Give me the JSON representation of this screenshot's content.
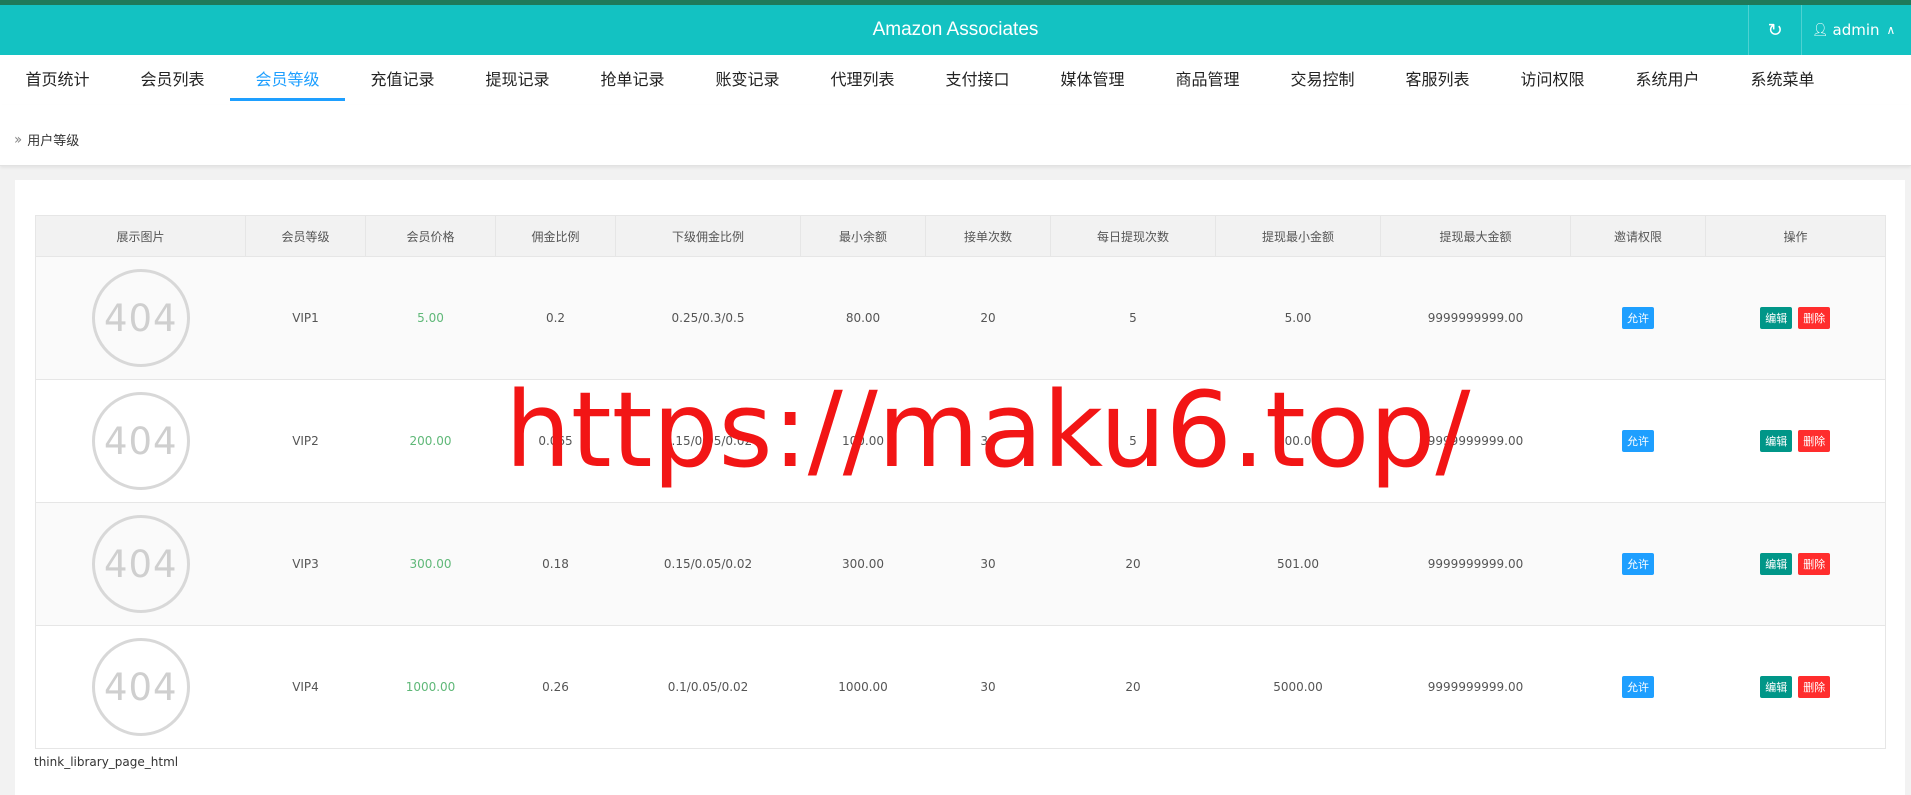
{
  "header": {
    "title": "Amazon Associates",
    "refresh_icon": "refresh-icon",
    "user": "admin"
  },
  "nav": {
    "items": [
      "首页统计",
      "会员列表",
      "会员等级",
      "充值记录",
      "提现记录",
      "抢单记录",
      "账变记录",
      "代理列表",
      "支付接口",
      "媒体管理",
      "商品管理",
      "交易控制",
      "客服列表",
      "访问权限",
      "系统用户",
      "系统菜单"
    ],
    "active_index": 2
  },
  "breadcrumb": {
    "label": "用户等级"
  },
  "table": {
    "headers": [
      "展示图片",
      "会员等级",
      "会员价格",
      "佣金比例",
      "下级佣金比例",
      "最小余额",
      "接单次数",
      "每日提现次数",
      "提现最小金额",
      "提现最大金额",
      "邀请权限",
      "操作"
    ],
    "rows": [
      {
        "image": "404",
        "level": "VIP1",
        "price": "5.00",
        "commission": "0.2",
        "sub_commission": "0.25/0.3/0.5",
        "min_balance": "80.00",
        "orders": "20",
        "daily_withdrawals": "5",
        "min_withdraw": "5.00",
        "max_withdraw": "9999999999.00",
        "invite": "允许",
        "edit": "编辑",
        "delete": "删除"
      },
      {
        "image": "404",
        "level": "VIP2",
        "price": "200.00",
        "commission": "0.065",
        "sub_commission": "0.15/0.05/0.02",
        "min_balance": "100.00",
        "orders": "30",
        "daily_withdrawals": "5",
        "min_withdraw": "100.00",
        "max_withdraw": "9999999999.00",
        "invite": "允许",
        "edit": "编辑",
        "delete": "删除"
      },
      {
        "image": "404",
        "level": "VIP3",
        "price": "300.00",
        "commission": "0.18",
        "sub_commission": "0.15/0.05/0.02",
        "min_balance": "300.00",
        "orders": "30",
        "daily_withdrawals": "20",
        "min_withdraw": "501.00",
        "max_withdraw": "9999999999.00",
        "invite": "允许",
        "edit": "编辑",
        "delete": "删除"
      },
      {
        "image": "404",
        "level": "VIP4",
        "price": "1000.00",
        "commission": "0.26",
        "sub_commission": "0.1/0.05/0.02",
        "min_balance": "1000.00",
        "orders": "30",
        "daily_withdrawals": "20",
        "min_withdraw": "5000.00",
        "max_withdraw": "9999999999.00",
        "invite": "允许",
        "edit": "编辑",
        "delete": "删除"
      }
    ]
  },
  "footer": {
    "text": "think_library_page_html"
  },
  "watermark": {
    "text": "https://maku6.top/"
  },
  "colors": {
    "topbar": "#13c2c2",
    "active_nav": "#1e9fff",
    "price": "#5fb878",
    "allow_badge": "#1e9fff",
    "edit_badge": "#009688",
    "delete_badge": "#ff2d2d",
    "watermark": "#f21515"
  }
}
